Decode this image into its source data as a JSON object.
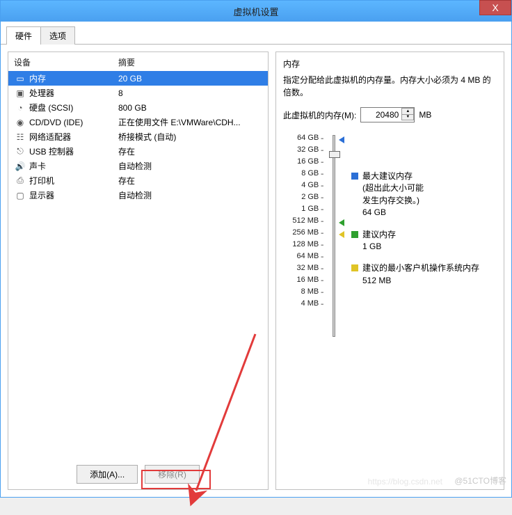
{
  "window": {
    "title": "虚拟机设置",
    "close": "X"
  },
  "tabs": {
    "hardware": "硬件",
    "options": "选项"
  },
  "hw_header": {
    "device": "设备",
    "summary": "摘要"
  },
  "hw": [
    {
      "icon": "memory-icon",
      "glyph": "▭",
      "name": "内存",
      "summary": "20 GB",
      "sel": true
    },
    {
      "icon": "cpu-icon",
      "glyph": "▣",
      "name": "处理器",
      "summary": "8"
    },
    {
      "icon": "hdd-icon",
      "glyph": "◔",
      "name": "硬盘 (SCSI)",
      "summary": "800 GB"
    },
    {
      "icon": "cd-icon",
      "glyph": "◉",
      "name": "CD/DVD (IDE)",
      "summary": "正在使用文件 E:\\VMWare\\CDH..."
    },
    {
      "icon": "nic-icon",
      "glyph": "☷",
      "name": "网络适配器",
      "summary": "桥接模式 (自动)"
    },
    {
      "icon": "usb-icon",
      "glyph": "⎋",
      "name": "USB 控制器",
      "summary": "存在"
    },
    {
      "icon": "sound-icon",
      "glyph": "🔊",
      "name": "声卡",
      "summary": "自动检测"
    },
    {
      "icon": "printer-icon",
      "glyph": "⎙",
      "name": "打印机",
      "summary": "存在"
    },
    {
      "icon": "display-icon",
      "glyph": "▢",
      "name": "显示器",
      "summary": "自动检测"
    }
  ],
  "buttons": {
    "add": "添加(A)...",
    "remove": "移除(R)"
  },
  "mem": {
    "title": "内存",
    "desc": "指定分配给此虚拟机的内存量。内存大小必须为 4 MB 的倍数。",
    "label": "此虚拟机的内存(M):",
    "value": "20480",
    "unit": "MB"
  },
  "ticks": [
    "64 GB",
    "32 GB",
    "16 GB",
    "8 GB",
    "4 GB",
    "2 GB",
    "1 GB",
    "512 MB",
    "256 MB",
    "128 MB",
    "64 MB",
    "32 MB",
    "16 MB",
    "8 MB",
    "4 MB"
  ],
  "legend": {
    "max": {
      "l1": "最大建议内存",
      "l2": "(超出此大小可能",
      "l3": "发生内存交换。)",
      "val": "64 GB"
    },
    "rec": {
      "l1": "建议内存",
      "val": "1 GB"
    },
    "min": {
      "l1": "建议的最小客户机操作系统内存",
      "val": "512 MB"
    }
  },
  "watermark": "@51CTO博客",
  "watermark2": "https://blog.csdn.net"
}
